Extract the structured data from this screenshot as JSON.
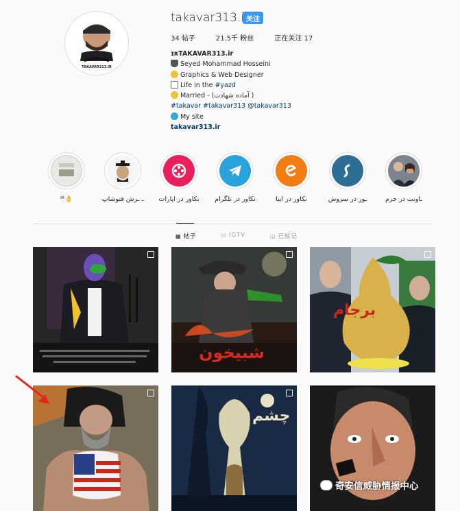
{
  "profile": {
    "username": "takavar313.ir",
    "follow_label": "关注",
    "posts": "34 帖子",
    "followers": "21.5千 粉丝",
    "following": "正在关注 17",
    "avatar_caption": "TAKAVAR313.IR",
    "bio": {
      "name": "ɪʀTAKAVAR313.ir",
      "full_name": "Seyed Mohammad Hosseini",
      "job": "Graphics & Web Designer",
      "location_prefix": "Life in the ",
      "location_tag": "#yazd",
      "status": "Married - (آماده شهادت )",
      "tags": "#takavar #takavar313 @takavar313",
      "site_label": "My site",
      "website": "takavar313.ir"
    }
  },
  "highlights": [
    {
      "label": "ᴵᴿ👌",
      "color": "#ffffff"
    },
    {
      "label": "ـ ـزش فتوشاپ",
      "color": "#ffffff"
    },
    {
      "label": "تکاور در آپارات",
      "color": "#ea1f5d"
    },
    {
      "label": "تکاور در تلگرام",
      "color": "#2aa3dd"
    },
    {
      "label": "تکاور در ایتا",
      "color": "#ef7d14"
    },
    {
      "label": "ـور در سروش",
      "color": "#2c6e94"
    },
    {
      "label": "ـاونت در جرم",
      "color": "#ffffff"
    }
  ],
  "tabs": [
    {
      "label": "帖子",
      "icon": "grid-icon",
      "active": true
    },
    {
      "label": "IGTV",
      "icon": "igtv-icon",
      "active": false
    },
    {
      "label": "已标记",
      "icon": "tag-icon",
      "active": false
    }
  ],
  "posts": [
    {
      "caption": "",
      "bg": "#2b2b2b"
    },
    {
      "caption": "شبیخون",
      "bg": "#3a3f3c"
    },
    {
      "caption": "برجام",
      "bg": "#b9c4c9"
    },
    {
      "caption": "",
      "bg": "#6d6a5c"
    },
    {
      "caption": "چشم",
      "bg": "#1b2a44"
    },
    {
      "caption": "",
      "bg": "#1e1e1e"
    }
  ],
  "watermark": {
    "text": "奇安信威胁情报中心"
  },
  "colors": {
    "accent": "#3897f0",
    "link": "#00376b",
    "arrow": "#e8231c"
  }
}
